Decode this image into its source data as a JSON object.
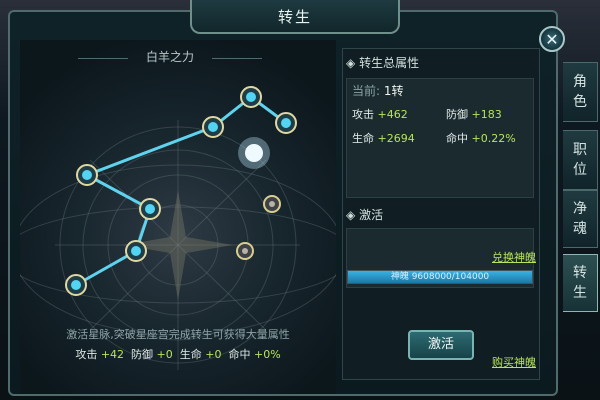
{
  "window": {
    "title": "转生",
    "close_icon": "close-icon"
  },
  "starmap": {
    "title": "白羊之力",
    "description": "激活星脉,突破星座宫完成转生可获得大量属性",
    "bonus": {
      "attack_label": "攻击",
      "attack_value": "+42",
      "defense_label": "防御",
      "defense_value": "+0",
      "hp_label": "生命",
      "hp_value": "+0",
      "hit_label": "命中",
      "hit_value": "+0%"
    }
  },
  "total": {
    "header": "转生总属性",
    "current_label": "当前:",
    "current_value": "1转",
    "attack_label": "攻击",
    "attack_value": "+462",
    "defense_label": "防御",
    "defense_value": "+183",
    "hp_label": "生命",
    "hp_value": "+2694",
    "hit_label": "命中",
    "hit_value": "+0.22%"
  },
  "activate": {
    "header": "激活",
    "exchange_link": "兑换神魄",
    "bar_text": "神魄  9608000/104000",
    "bar_fraction": 1.0,
    "button_label": "激活",
    "buy_link": "购买神魄"
  },
  "tabs": [
    {
      "label": "角色",
      "active": false
    },
    {
      "label": "职位",
      "active": false
    },
    {
      "label": "净魂",
      "active": false
    },
    {
      "label": "转生",
      "active": true
    }
  ],
  "colors": {
    "accent_green": "#b8e35a",
    "node_cyan": "#38c6e8",
    "bar_blue": "#2a9bd0"
  }
}
